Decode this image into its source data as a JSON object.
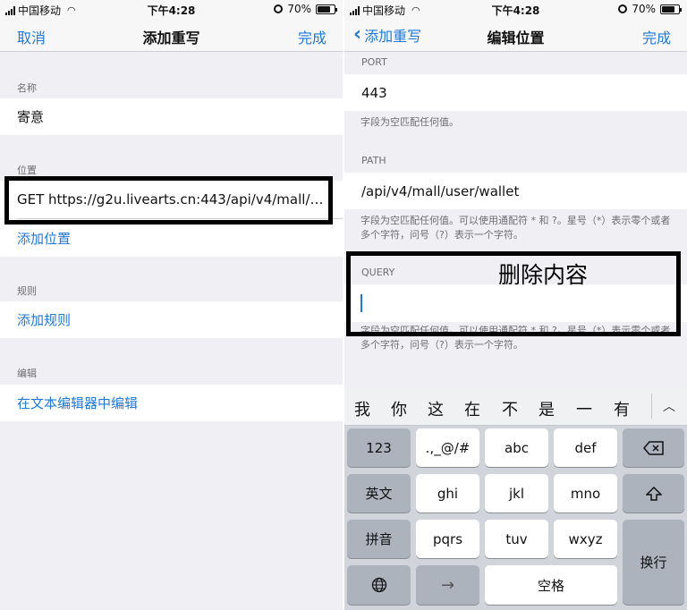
{
  "status_bar": {
    "carrier": "中国移动",
    "time": "下午4:28",
    "battery": "70%"
  },
  "left_screen": {
    "nav": {
      "cancel_label": "取消",
      "title": "添加重写",
      "done_label": "完成"
    },
    "name_section": {
      "header": "名称",
      "value": "寄意"
    },
    "location_section": {
      "header": "位置",
      "value": "GET https://g2u.livearts.cn:443/api/v4/mall/us...",
      "add_label": "添加位置"
    },
    "rules_section": {
      "header": "规则",
      "add_label": "添加规则"
    },
    "edit_section": {
      "header": "编辑",
      "edit_label": "在文本编辑器中编辑"
    }
  },
  "right_screen": {
    "nav": {
      "back_label": "添加重写",
      "title": "编辑位置",
      "done_label": "完成"
    },
    "port": {
      "header": "PORT",
      "value": "443",
      "hint": "字段为空匹配任何值。"
    },
    "path": {
      "header": "PATH",
      "value": "/api/v4/mall/user/wallet",
      "hint": "字段为空匹配任何值。可以使用通配符 * 和 ?。星号（*）表示零个或者多个字符，问号（?）表示一个字符。"
    },
    "query": {
      "header": "QUERY",
      "value": "",
      "hint": "字段为空匹配任何值。可以使用通配符 * 和 ?。星号（*）表示零个或者多个字符，问号（?）表示一个字符。"
    },
    "annotation": "删除内容"
  },
  "keyboard": {
    "candidates": [
      "我",
      "你",
      "这",
      "在",
      "不",
      "是",
      "一",
      "有"
    ],
    "keys": {
      "num": "123",
      "punct": ".,_@/#",
      "abc": "abc",
      "def": "def",
      "lang": "英文",
      "ghi": "ghi",
      "jkl": "jkl",
      "mno": "mno",
      "pinyin": "拼音",
      "pqrs": "pqrs",
      "tuv": "tuv",
      "wxyz": "wxyz",
      "space": "空格",
      "enter": "换行"
    }
  },
  "colors": {
    "accent": "#1f79d8",
    "group_bg": "#efeff4",
    "keyboard_bg": "#d1d5db"
  }
}
